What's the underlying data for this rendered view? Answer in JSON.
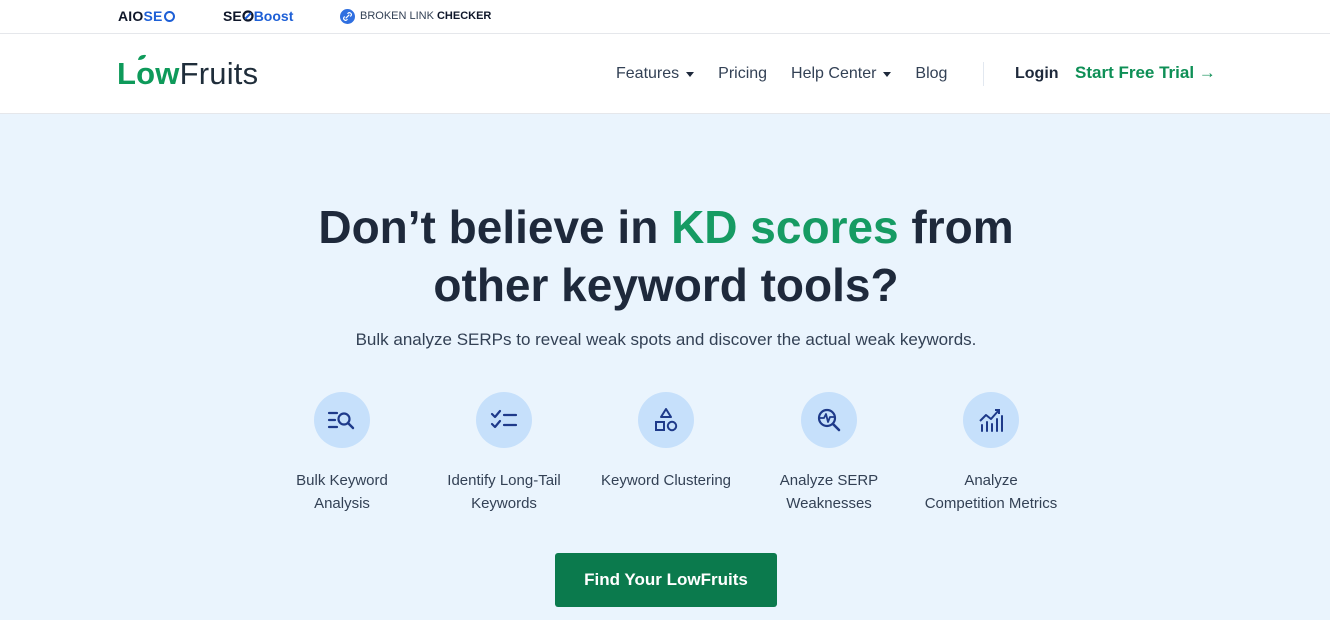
{
  "brandbar": {
    "aioseo": {
      "part1": "AIO",
      "part2": "SE"
    },
    "seoboost": {
      "part1": "SE",
      "part2": "Boost"
    },
    "blc": {
      "light": "BROKEN LINK",
      "strong": "CHECKER"
    }
  },
  "nav": {
    "logo": {
      "part1": "Low",
      "part2": "Fruits"
    },
    "items": [
      {
        "label": "Features",
        "dropdown": true
      },
      {
        "label": "Pricing",
        "dropdown": false
      },
      {
        "label": "Help Center",
        "dropdown": true
      },
      {
        "label": "Blog",
        "dropdown": false
      }
    ],
    "login": "Login",
    "trial": "Start Free Trial →"
  },
  "hero": {
    "headline_pre": "Don’t believe in ",
    "headline_highlight": "KD scores",
    "headline_post": " from",
    "headline_line2": "other keyword tools?",
    "subtitle": "Bulk analyze SERPs to reveal weak spots and discover the actual weak keywords.",
    "features": [
      {
        "icon": "search-list-icon",
        "line1": "Bulk Keyword",
        "line2": "Analysis"
      },
      {
        "icon": "checklist-icon",
        "line1": "Identify Long-Tail",
        "line2": "Keywords"
      },
      {
        "icon": "shapes-icon",
        "line1": "Keyword Clustering",
        "line2": ""
      },
      {
        "icon": "pulse-search-icon",
        "line1": "Analyze SERP",
        "line2": "Weaknesses"
      },
      {
        "icon": "chart-icon",
        "line1": "Analyze",
        "line2": "Competition Metrics"
      }
    ],
    "cta": "Find Your LowFruits"
  },
  "colors": {
    "accent_green": "#169b63",
    "cta_green": "#0b7a4d",
    "hero_bg": "#eaf4fd",
    "icon_circle": "#c6e0fb",
    "icon_stroke": "#1e3a8a"
  }
}
